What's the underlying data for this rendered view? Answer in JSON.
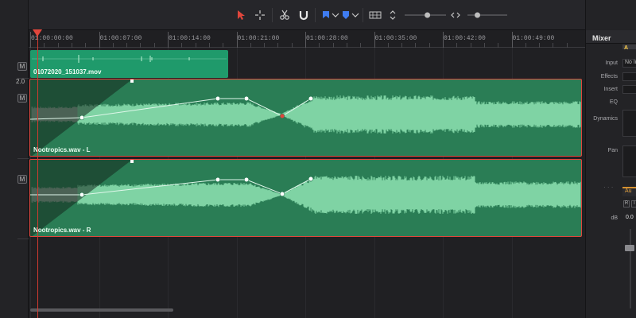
{
  "toolbar": {
    "tools": [
      {
        "name": "selection-tool",
        "color": "#e0463c"
      },
      {
        "name": "range-tool",
        "color": "#c8c8c8"
      },
      {
        "name": "blade-tool",
        "color": "#c8c8c8"
      },
      {
        "name": "snapping-tool",
        "color": "#e6e6e6"
      },
      {
        "name": "flag-tool",
        "color": "#3f7cf0"
      },
      {
        "name": "marker-tool",
        "color": "#3f7cf0"
      }
    ],
    "zoom_level": 0.55,
    "zoom2_level": 0.25
  },
  "ruler": {
    "timecodes": [
      "01:00:00:00",
      "01:00:07:00",
      "01:00:14:00",
      "01:00:21:00",
      "01:00:28:00",
      "01:00:35:00",
      "01:00:42:00",
      "01:00:49:00"
    ]
  },
  "track_headers": {
    "mute_label": "M",
    "zoom_value": "2.0"
  },
  "clips": {
    "video": {
      "name": "01072020_151037.mov"
    },
    "audio_left": {
      "name": "Nootropics.wav - L"
    },
    "audio_right": {
      "name": "Nootropics.wav - R"
    }
  },
  "mixer": {
    "title": "Mixer",
    "strip_label": "A",
    "rows": [
      {
        "label": "Input",
        "value": "No In"
      },
      {
        "label": "Effects",
        "value": ""
      },
      {
        "label": "Insert",
        "value": ""
      },
      {
        "label": "EQ",
        "value": ""
      },
      {
        "label": "Dynamics",
        "value": ""
      },
      {
        "label": "Pan",
        "value": ""
      }
    ],
    "channel_label": "Au",
    "rb_buttons": [
      "R",
      "I"
    ],
    "db_label": "dB",
    "db_value": "0.0",
    "dots": "· · ·"
  },
  "colors": {
    "accent": "#e0463c",
    "audio_clip": "#2a7d55",
    "waveform": "#7fd3a4",
    "video_clip": "#1f9a6b"
  }
}
